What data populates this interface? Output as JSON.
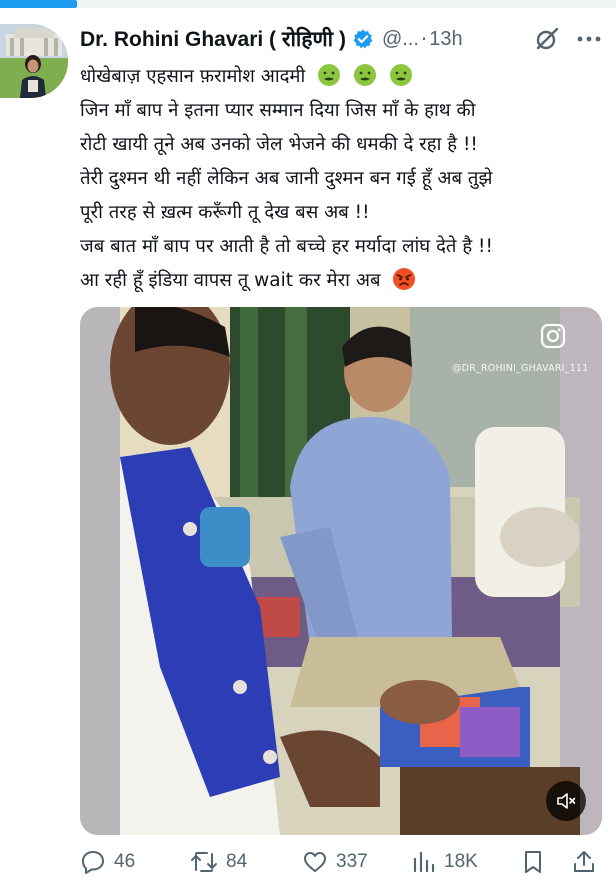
{
  "progress": {
    "fraction": 0.125,
    "color": "#1d9bf0"
  },
  "author": {
    "name": "Dr. Rohini Ghavari ( रोहिणी )",
    "handle": "@...",
    "separator": "·",
    "time": "13h",
    "verified_color": "#1d9bf0"
  },
  "tweet": {
    "lines": [
      "धोखेबाज़ एहसान फ़रामोश आदमी",
      "जिन माँ बाप ने इतना प्यार सम्मान दिया जिस माँ के हाथ की",
      "रोटी खायी तूने अब उनको जेल भेजने की धमकी दे रहा है !!",
      "तेरी दुश्मन थी नहीं लेकिन अब जानी दुश्मन बन गई हूँ अब तुझे",
      "पूरी तरह से ख़त्म करूँगी तू देख बस अब !!",
      "जब बात माँ बाप पर आती है तो बच्चे हर मर्यादा लांघ देते है !!",
      "आ रही हूँ इंडिया वापस तू wait कर मेरा अब"
    ],
    "line1_emojis": [
      "nauseated-face-icon",
      "nauseated-face-icon",
      "nauseated-face-icon"
    ],
    "line7_emoji": "angry-face-icon"
  },
  "media": {
    "watermark": "@DR_ROHINI_GHAVARI_111",
    "icons": [
      "instagram-icon",
      "mute-icon"
    ]
  },
  "actions": {
    "replies": "46",
    "reposts": "84",
    "likes": "337",
    "views": "18K",
    "icons": [
      "reply-icon",
      "repost-icon",
      "like-icon",
      "views-icon",
      "bookmark-icon",
      "share-icon"
    ]
  }
}
